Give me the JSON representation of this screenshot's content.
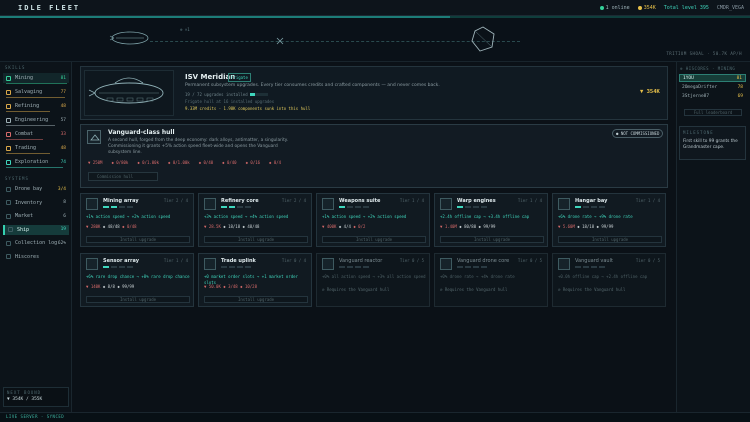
{
  "app": {
    "title": "IDLE FLEET"
  },
  "status": {
    "online": "1 online",
    "credits": "354K",
    "total_level": "Total level 395",
    "user": "CMDR_VEGA"
  },
  "lane": {
    "speed": "⊕ ×1",
    "readout": "TRITIUM SHOAL · 50.7K AP/H"
  },
  "sidebar": {
    "skills_label": "SKILLS",
    "skills": [
      {
        "label": "Mining",
        "value": "81",
        "color": "#34d29a"
      },
      {
        "label": "Salvaging",
        "value": "77",
        "color": "#d8a84a"
      },
      {
        "label": "Refining",
        "value": "48",
        "color": "#d8a84a"
      },
      {
        "label": "Engineering",
        "value": "57",
        "color": "#9fb0b6"
      },
      {
        "label": "Combat",
        "value": "33",
        "color": "#d66a6a"
      },
      {
        "label": "Trading",
        "value": "48",
        "color": "#d8a84a"
      },
      {
        "label": "Exploration",
        "value": "74",
        "color": "#3fd6bd"
      }
    ],
    "systems_label": "SYSTEMS",
    "systems": [
      {
        "label": "Drone bay",
        "value": "3/4",
        "color": "#e8c14a"
      },
      {
        "label": "Inventory",
        "value": "8",
        "color": "#9fb0b6"
      },
      {
        "label": "Market",
        "value": "6",
        "color": "#9fb0b6"
      },
      {
        "label": "Ship",
        "value": "19",
        "color": "#3fd6bd"
      },
      {
        "label": "Collection log",
        "value": "62%",
        "color": "#9fb0b6"
      },
      {
        "label": "Hiscores",
        "value": "",
        "color": "#9fb0b6"
      }
    ],
    "best_label": "NEXT BOUND",
    "best_value": "▼ 354K / 355K"
  },
  "hero": {
    "name": "ISV Meridian",
    "badge": "Frigate",
    "desc": "Permanent subsystem upgrades. Every tier consumes credits and crafted components — and never comes back.",
    "upgrades": "19 / 72 upgrades installed",
    "upgrade_progress": 0.26,
    "hint": "Frigate hull at 16 installed upgrades",
    "stats": "9.33M credits · 1.98K components sunk into this hull",
    "credits": "▼ 354K"
  },
  "vanguard": {
    "title": "Vanguard-class hull",
    "desc": "A second hull, forged from the deep economy: dark alloys, antimatter, a singularity. Commissioning it grants +5% action speed fleet-wide and opens the Vanguard subsystem line.",
    "badge": "● NOT COMMISSIONED",
    "costs": [
      "▼ 250M",
      "◆ 0/80k",
      "◆ 0/1.00k",
      "◆ 0/1.00k",
      "◆ 0/40",
      "◆ 0/40",
      "◆ 0/16",
      "◆ 0/4"
    ],
    "button": "Commission hull"
  },
  "cards": [
    {
      "name": "Mining array",
      "tier": "Tier 2 / 4",
      "pips": 2,
      "effect": "+1% action speed → +2% action speed",
      "cost": [
        "▼ 280K",
        "◆ 48/48",
        "◆ 0/48"
      ],
      "button": "Install upgrade",
      "locked": false
    },
    {
      "name": "Refinery core",
      "tier": "Tier 2 / 4",
      "pips": 2,
      "effect": "+3% action speed → +4% action speed",
      "cost": [
        "▼ 28.5K",
        "◆ 18/18",
        "◆ 48/48"
      ],
      "button": "Install upgrade",
      "locked": false
    },
    {
      "name": "Weapons suite",
      "tier": "Tier 1 / 4",
      "pips": 1,
      "effect": "+1% action speed → +2% action speed",
      "cost": [
        "▼ 400K",
        "◆ 4/4",
        "◆ 0/2"
      ],
      "button": "Install upgrade",
      "locked": false
    },
    {
      "name": "Warp engines",
      "tier": "Tier 1 / 4",
      "pips": 1,
      "effect": "+2.4h offline cap → +3.4h offline cap",
      "cost": [
        "▼ 1.40M",
        "◆ 80/80",
        "◆ 99/99"
      ],
      "button": "Install upgrade",
      "locked": false
    },
    {
      "name": "Hangar bay",
      "tier": "Tier 1 / 4",
      "pips": 1,
      "effect": "+6% drone rate → +9% drone rate",
      "cost": [
        "▼ 5.60M",
        "◆ 18/18",
        "◆ 99/99"
      ],
      "button": "Install upgrade",
      "locked": false
    },
    {
      "name": "Sensor array",
      "tier": "Tier 1 / 4",
      "pips": 1,
      "effect": "+6% rare drop chance → +8% rare drop chance",
      "cost": [
        "▼ 140K",
        "◆ 8/8",
        "◆ 99/99"
      ],
      "button": "Install upgrade",
      "locked": false
    },
    {
      "name": "Trade uplink",
      "tier": "Tier 0 / 4",
      "pips": 0,
      "effect": "+0 market order slots → +1 market order slots",
      "cost": [
        "▼ 50.0K",
        "◆ 3/48",
        "◆ 10/28"
      ],
      "button": "Install upgrade",
      "locked": false
    },
    {
      "name": "Vanguard reactor",
      "tier": "Tier 0 / 5",
      "pips": 0,
      "effect": "+0% all action speed → +3% all action speed",
      "req": "⊘ Requires the Vanguard hull",
      "locked": true
    },
    {
      "name": "Vanguard drone core",
      "tier": "Tier 0 / 5",
      "pips": 0,
      "effect": "+0% drone rate → +4% drone rate",
      "req": "⊘ Requires the Vanguard hull",
      "locked": true
    },
    {
      "name": "Vanguard vault",
      "tier": "Tier 0 / 5",
      "pips": 0,
      "effect": "+0.0h offline cap → +2.4h offline cap",
      "req": "⊘ Requires the Vanguard hull",
      "locked": true
    }
  ],
  "hiscores": {
    "title": "⊕ HISCORES · MINING",
    "rows": [
      {
        "rank": "1",
        "name": "YOU",
        "value": "81"
      },
      {
        "rank": "2",
        "name": "OmegaDrifter",
        "value": "78"
      },
      {
        "rank": "3",
        "name": "Stjerne87",
        "value": "69"
      }
    ],
    "button": "Full leaderboard"
  },
  "milestone": {
    "title": "MILESTONE",
    "text": "First skill to 99 grants the Grandmaster cape."
  },
  "footer": {
    "text": "LIVE SERVER · SYNCED"
  }
}
